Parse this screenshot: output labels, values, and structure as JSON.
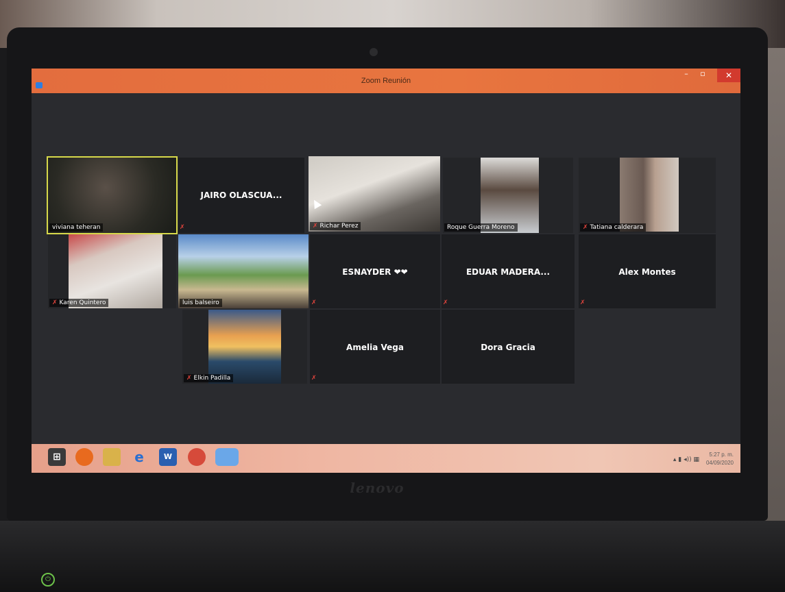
{
  "window": {
    "title": "Zoom Reunión"
  },
  "participants": [
    {
      "name": "viviana teheran",
      "video": true,
      "active_speaker": true,
      "muted": false
    },
    {
      "name": "JAIRO OLASCUA...",
      "video": false,
      "muted": true
    },
    {
      "name": "Richar Perez",
      "video": true,
      "muted": true
    },
    {
      "name": "Roque Guerra Moreno",
      "video": true,
      "muted": false
    },
    {
      "name": "Tatiana calderara",
      "video": true,
      "muted": true
    },
    {
      "name": "Karen Quintero",
      "video": true,
      "muted": true
    },
    {
      "name": "luis balseiro",
      "video": true,
      "muted": false
    },
    {
      "name": "ESNAYDER ❤❤",
      "video": false,
      "muted": true
    },
    {
      "name": "EDUAR MADERA...",
      "video": false,
      "muted": true
    },
    {
      "name": "Alex Montes",
      "video": false,
      "muted": true
    },
    {
      "name": "Elkin Padilla",
      "video": true,
      "muted": true
    },
    {
      "name": "Amelia Vega",
      "video": false,
      "muted": true
    },
    {
      "name": "Dora Gracia",
      "video": false,
      "muted": false
    }
  ],
  "taskbar": {
    "apps": [
      "start-icon",
      "firefox-icon",
      "file-explorer-icon",
      "internet-explorer-icon",
      "word-icon",
      "chrome-icon",
      "zoom-icon"
    ],
    "ie_glyph": "e",
    "word_glyph": "W",
    "tray_time": "5:27 p. m.",
    "tray_date": "04/09/2020"
  },
  "device": {
    "brand": "lenovo"
  },
  "colors": {
    "title_bar": "#e8753f",
    "active_speaker_border": "#d7d94a",
    "mute_icon": "#e0443c",
    "gallery_bg": "#2a2b2f"
  }
}
